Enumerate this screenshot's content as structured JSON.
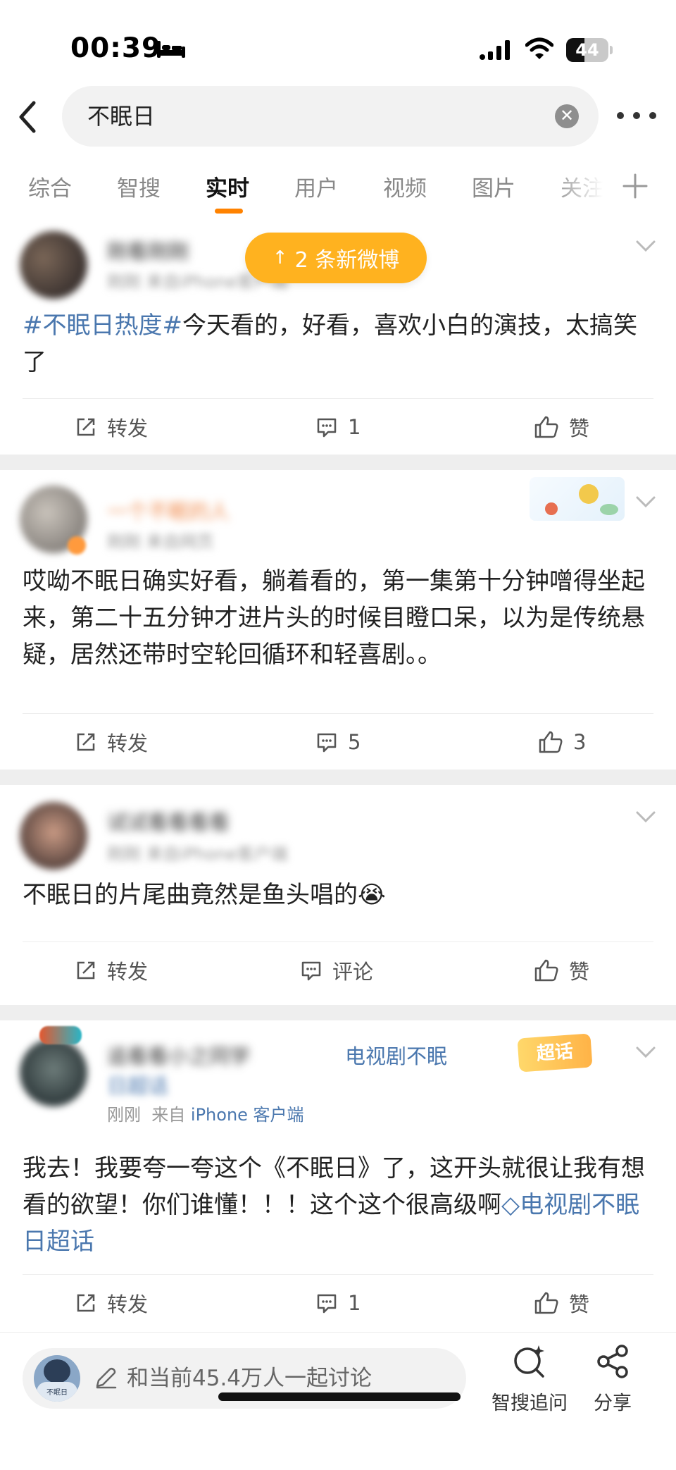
{
  "status_bar": {
    "time": "00:39",
    "battery": "44",
    "battery_level": 0.44,
    "icons": [
      "bed-icon",
      "signal-icon",
      "wifi-icon",
      "battery-icon"
    ]
  },
  "search": {
    "query": "不眠日"
  },
  "tabs": [
    {
      "label": "综合",
      "active": false
    },
    {
      "label": "智搜",
      "active": false
    },
    {
      "label": "实时",
      "active": true
    },
    {
      "label": "用户",
      "active": false
    },
    {
      "label": "视频",
      "active": false
    },
    {
      "label": "图片",
      "active": false
    },
    {
      "label": "关注",
      "active": false
    }
  ],
  "accent_color": "#ff8200",
  "link_color": "#4a77ae",
  "new_weibo": {
    "label": "2 条新微博"
  },
  "posts": [
    {
      "username": "刚看刚刚",
      "meta": "刚刚 来自iPhone客户端",
      "hashtag": "#不眠日热度#",
      "text": "今天看的，好看，喜欢小白的演技，太搞笑了",
      "repost_label": "转发",
      "comment_label": "1",
      "like_label": "赞"
    },
    {
      "username": "一个不眠的人",
      "meta": "刚刚 来自网页",
      "text": "哎呦不眠日确实好看，躺着看的，第一集第十分钟噌得坐起来，第二十五分钟才进片头的时候目瞪口呆，以为是传统悬疑，居然还带时空轮回循环和轻喜剧。。",
      "repost_label": "转发",
      "comment_label": "5",
      "like_label": "3"
    },
    {
      "username": "试试看看看看",
      "meta": "刚刚 来自iPhone客户端",
      "text": "不眠日的片尾曲竟然是鱼头唱的😭",
      "repost_label": "转发",
      "comment_label": "评论",
      "like_label": "赞"
    },
    {
      "username": "追看看小之同学",
      "source_prefix": "电视剧不眠",
      "source_suffix": "日超话",
      "badge": "超话",
      "meta_time": "刚刚",
      "meta_from": "来自",
      "meta_device": "iPhone 客户端",
      "text": "我去！我要夸一夸这个《不眠日》了，这开头就很让我有想看的欲望！你们谁懂！！！这个这个很高级啊",
      "topic_link": "电视剧不眠日超话",
      "repost_label": "转发",
      "comment_label": "1",
      "like_label": "赞"
    }
  ],
  "bottom_bar": {
    "discuss_placeholder": "和当前45.4万人一起讨论",
    "avatar_caption": "不眠日",
    "smart_search_label": "智搜追问",
    "share_label": "分享"
  }
}
